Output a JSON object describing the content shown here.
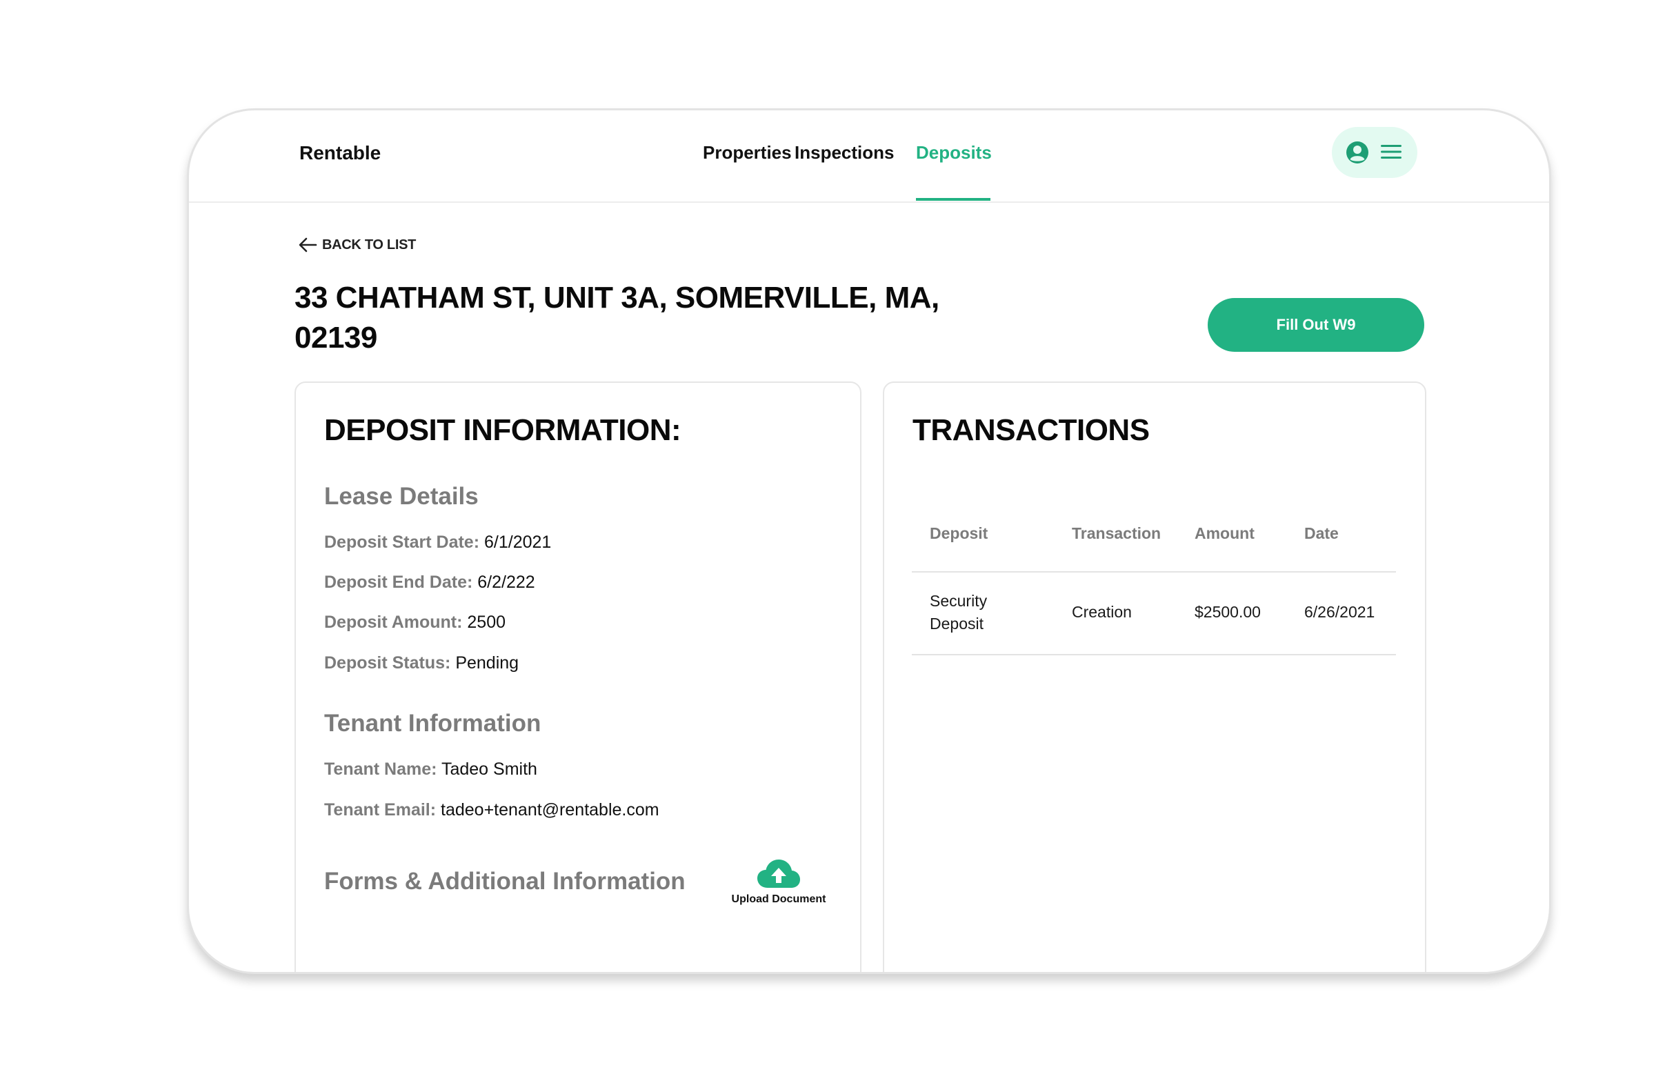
{
  "header": {
    "brand": "Rentable",
    "nav": [
      {
        "label": "Properties",
        "active": false
      },
      {
        "label": "Inspections",
        "active": false
      },
      {
        "label": "Deposits",
        "active": true
      }
    ],
    "user_icon": "user-circle-icon",
    "menu_icon": "hamburger-menu-icon"
  },
  "back": {
    "icon": "arrow-left-icon",
    "label": "BACK TO LIST"
  },
  "address": {
    "line1": "33 CHATHAM ST, UNIT 3A, SOMERVILLE, MA,",
    "line2": "02139"
  },
  "actions": {
    "w9_label": "Fill Out W9"
  },
  "deposit_info": {
    "title": "DEPOSIT INFORMATION:",
    "lease_heading": "Lease Details",
    "start_date": {
      "label": "Deposit Start Date:",
      "value": "6/1/2021"
    },
    "end_date": {
      "label": "Deposit End Date:",
      "value": "6/2/222"
    },
    "amount": {
      "label": "Deposit Amount:",
      "value": "2500"
    },
    "status": {
      "label": "Deposit Status:",
      "value": "Pending"
    },
    "tenant_heading": "Tenant Information",
    "tenant_name": {
      "label": "Tenant Name:",
      "value": "Tadeo Smith"
    },
    "tenant_email": {
      "label": "Tenant Email:",
      "value": "tadeo+tenant@rentable.com"
    },
    "forms_heading": "Forms & Additional Information",
    "upload_icon": "cloud-upload-icon",
    "upload_label": "Upload Document"
  },
  "transactions": {
    "title": "TRANSACTIONS",
    "columns": [
      "Deposit",
      "Transaction",
      "Amount",
      "Date"
    ],
    "rows": [
      {
        "deposit": "Security Deposit",
        "transaction": "Creation",
        "amount": "$2500.00",
        "date": "6/26/2021"
      }
    ]
  },
  "colors": {
    "accent": "#22b283",
    "accent_light": "#e3faf1",
    "muted_text": "#7b7b7b",
    "border": "#e6e6e6"
  }
}
